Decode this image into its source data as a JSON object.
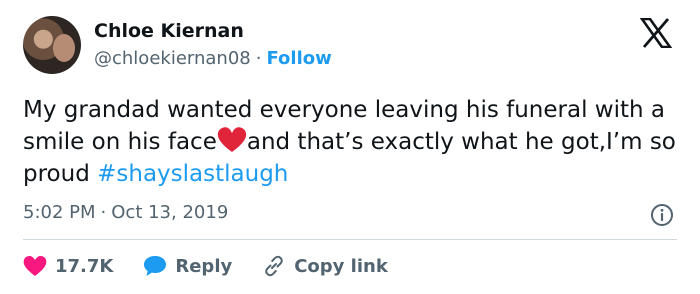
{
  "author": {
    "name": "Chloe Kiernan",
    "handle": "@chloekiernan08",
    "separator": "·",
    "follow_label": "Follow"
  },
  "tweet": {
    "text_part1": "My grandad wanted everyone leaving his funeral with a smile on his face",
    "text_part2": "and that’s exactly what he got,I’m so proud ",
    "hashtag": "#shayslastlaugh"
  },
  "meta": {
    "time": "5:02 PM",
    "separator": "·",
    "date": "Oct 13, 2019"
  },
  "actions": {
    "likes": "17.7K",
    "reply_label": "Reply",
    "copy_link_label": "Copy link"
  },
  "icons": {
    "platform_logo": "x-logo-icon",
    "info": "info-icon",
    "like": "heart-icon",
    "reply": "speech-bubble-icon",
    "copy_link": "link-icon",
    "inline_emoji": "red-heart-emoji-icon"
  },
  "colors": {
    "accent": "#1d9bf0",
    "like": "#f91880",
    "text": "#0f1419",
    "secondary": "#536471",
    "heart_emoji": "#e0243a"
  }
}
